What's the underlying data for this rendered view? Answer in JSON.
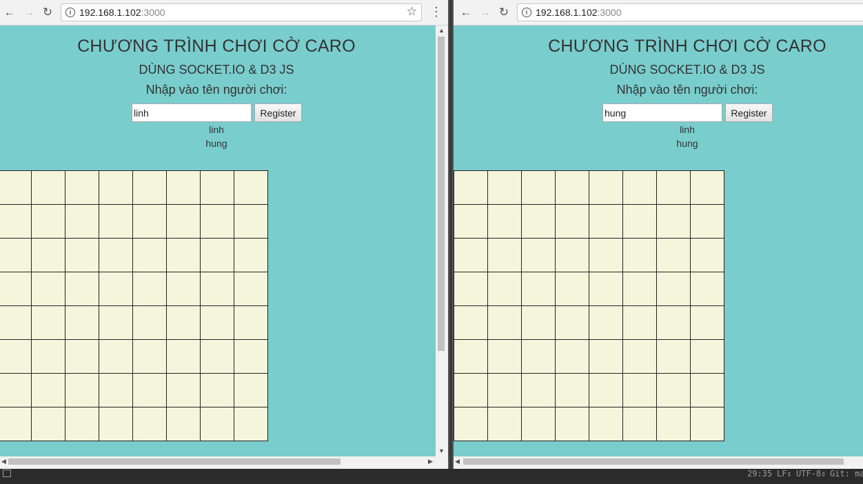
{
  "windows": [
    {
      "url_host": "192.168.1.102",
      "url_port": ":3000",
      "page": {
        "title": "CHƯƠNG TRÌNH CHƠI CỜ CARO",
        "subtitle": "DÙNG SOCKET.IO & D3 JS",
        "prompt": "Nhập vào tên người chơi:",
        "name_value": "linh",
        "register_label": "Register",
        "players": [
          "linh",
          "hung"
        ]
      }
    },
    {
      "url_host": "192.168.1.102",
      "url_port": ":3000",
      "page": {
        "title": "CHƯƠNG TRÌNH CHƠI CỜ CARO",
        "subtitle": "DÙNG SOCKET.IO & D3 JS",
        "prompt": "Nhập vào tên người chơi:",
        "name_value": "hung",
        "register_label": "Register",
        "players": [
          "linh",
          "hung"
        ]
      }
    }
  ],
  "board": {
    "rows": 8,
    "cols": 8,
    "cell_color": "#f5f5dc"
  },
  "colors": {
    "page_background": "#79cdcd",
    "grid_line": "#222222"
  },
  "icons": {
    "back": "arrow-left-icon",
    "forward": "arrow-right-icon",
    "reload": "reload-icon",
    "info": "info-icon",
    "bookmark": "star-icon",
    "menu": "kebab-menu-icon"
  },
  "statusbar": {
    "position": "29:35",
    "line_ending": "LF",
    "encoding": "UTF-8",
    "git": "Git: mas"
  }
}
